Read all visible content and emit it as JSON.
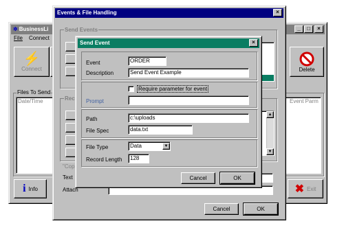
{
  "business_window": {
    "title": "BusinessLi",
    "menu": [
      "File",
      "Connect"
    ],
    "connect_label": "Connect",
    "delete_label": "Delete",
    "files_group_label": "Files To Send",
    "col_datetime": "Date/Time",
    "col_event_parm": "Event Parm",
    "info_label": "Info",
    "exit_label": "Exit"
  },
  "events_window": {
    "title": "Events & File Handling",
    "send_events_label": "Send Events",
    "rec_label": "Rec",
    "cop_label": "\"Cop",
    "text_label": "Text",
    "attach_label": "Attach",
    "cancel_label": "Cancel",
    "ok_label": "OK"
  },
  "send_event_dialog": {
    "title": "Send Event",
    "event_label": "Event",
    "event_value": "ORDER",
    "description_label": "Description",
    "description_value": "Send Event Example",
    "require_param_label": "Require parameter for event",
    "require_param_checked": false,
    "prompt_label": "Prompt",
    "prompt_value": "",
    "path_label": "Path",
    "path_value": "c:\\uploads",
    "filespec_label": "File Spec",
    "filespec_value": "data.txt",
    "filetype_label": "File Type",
    "filetype_value": "Data",
    "recordlength_label": "Record Length",
    "recordlength_value": "128",
    "cancel_label": "Cancel",
    "ok_label": "OK"
  },
  "colors": {
    "active_title": "#000080",
    "green_title": "#0a7d62",
    "inactive_title": "#808080",
    "face": "#c0c0c0"
  }
}
